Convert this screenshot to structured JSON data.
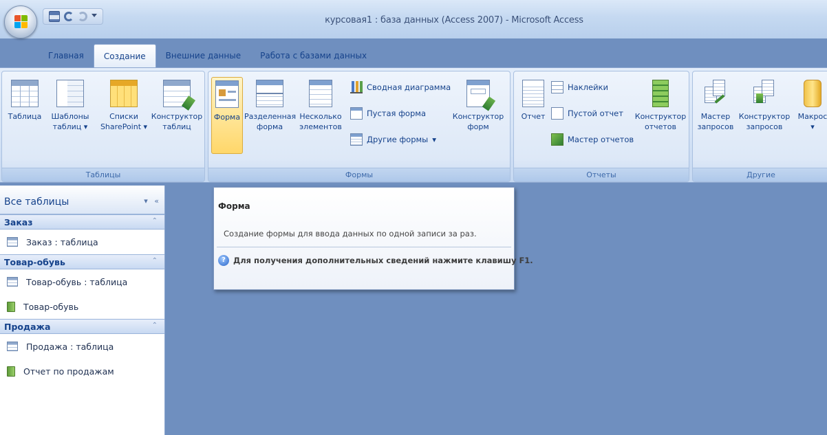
{
  "window": {
    "title": "курсовая1 : база данных (Access 2007) - Microsoft Access"
  },
  "tabs": [
    {
      "label": "Главная"
    },
    {
      "label": "Создание"
    },
    {
      "label": "Внешние данные"
    },
    {
      "label": "Работа с базами данных"
    }
  ],
  "ribbon": {
    "tables": {
      "label": "Таблицы",
      "table": [
        "Таблица",
        ""
      ],
      "templates": [
        "Шаблоны",
        "таблиц"
      ],
      "lists": [
        "Списки",
        "SharePoint"
      ],
      "designer": [
        "Конструктор",
        "таблиц"
      ]
    },
    "forms": {
      "label": "Формы",
      "form": [
        "Форма",
        ""
      ],
      "split": [
        "Разделенная",
        "форма"
      ],
      "multiple": [
        "Несколько",
        "элементов"
      ],
      "pivot_chart": "Сводная диаграмма",
      "blank_form": "Пустая форма",
      "other_forms": "Другие формы",
      "designer": [
        "Конструктор",
        "форм"
      ]
    },
    "reports": {
      "label": "Отчеты",
      "report": [
        "Отчет",
        ""
      ],
      "labels": "Наклейки",
      "blank_report": "Пустой отчет",
      "wizard": "Мастер отчетов",
      "designer": [
        "Конструктор",
        "отчетов"
      ]
    },
    "other": {
      "label": "Другие",
      "query_wizard": [
        "Мастер",
        "запросов"
      ],
      "query_designer": [
        "Конструктор",
        "запросов"
      ],
      "macro": [
        "Макрос",
        ""
      ]
    }
  },
  "nav": {
    "header": "Все таблицы",
    "groups": [
      {
        "title": "Заказ",
        "items": [
          "Заказ : таблица"
        ]
      },
      {
        "title": "Товар-обувь",
        "items": [
          "Товар-обувь : таблица",
          "Товар-обувь"
        ]
      },
      {
        "title": "Продажа",
        "items": [
          "Продажа : таблица",
          "Отчет по продажам"
        ]
      }
    ]
  },
  "tooltip": {
    "title": "Форма",
    "description": "Создание формы для ввода данных по одной записи за раз.",
    "help": "Для получения дополнительных сведений нажмите клавишу F1."
  }
}
